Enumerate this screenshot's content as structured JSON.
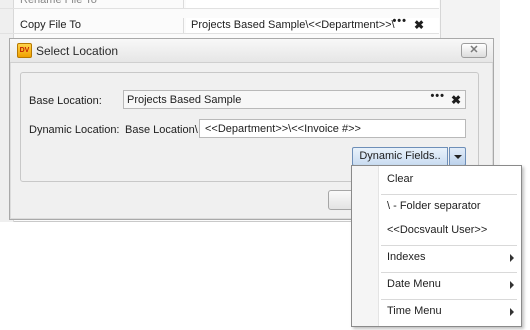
{
  "background": {
    "rows": [
      {
        "name": "Rename File To",
        "value": ""
      },
      {
        "name": "Copy File To",
        "value": "Projects Based Sample\\<<Department>>\\"
      }
    ],
    "ellipsis": "•••",
    "clear_glyph": "✖"
  },
  "dialog": {
    "title": "Select Location",
    "app_icon_text": "DV",
    "close_glyph": "✕",
    "base_location_label": "Base Location:",
    "base_location_value": "Projects Based Sample",
    "dynamic_location_label": "Dynamic Location:",
    "dynamic_prefix": "Base Location\\",
    "dynamic_value": "<<Department>>\\<<Invoice #>>",
    "dynamic_fields_button": "Dynamic Fields..",
    "ellipsis": "•••",
    "clear_glyph": "✖"
  },
  "menu": {
    "items": [
      {
        "label": "Clear",
        "submenu": false
      },
      {
        "label": "\\ - Folder separator",
        "submenu": false
      },
      {
        "label": "<<Docsvault User>>",
        "submenu": false
      },
      {
        "label": "Indexes",
        "submenu": true
      },
      {
        "label": "Date Menu",
        "submenu": true
      },
      {
        "label": "Time Menu",
        "submenu": true
      }
    ]
  }
}
